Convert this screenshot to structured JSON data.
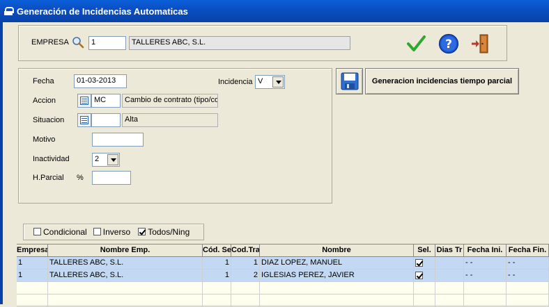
{
  "window": {
    "title": "Generación de Incidencias Automaticas"
  },
  "empresa": {
    "label": "EMPRESA",
    "code": "1",
    "name": "TALLERES ABC, S.L."
  },
  "form": {
    "fecha_label": "Fecha",
    "fecha_value": "01-03-2013",
    "incidencia_label": "Incidencia",
    "incidencia_value": "V",
    "accion_label": "Accion",
    "accion_code": "MC",
    "accion_desc": "Cambio de contrato (tipo/coe",
    "situacion_label": "Situacion",
    "situacion_code": "",
    "situacion_desc": "Alta",
    "motivo_label": "Motivo",
    "motivo_value": "",
    "inactividad_label": "Inactividad",
    "inactividad_value": "2",
    "hparcial_label": "H.Parcial",
    "hparcial_unit": "%",
    "hparcial_value": ""
  },
  "actions": {
    "generate_label": "Generacion incidencias tiempo parcial"
  },
  "filters": {
    "condicional_label": "Condicional",
    "condicional_checked": false,
    "inverso_label": "Inverso",
    "inverso_checked": false,
    "todos_label": "Todos/Ning",
    "todos_checked": true
  },
  "table": {
    "headers": [
      "Empresa",
      "Nombre Emp.",
      "Cód. Se",
      "Cod.Tra",
      "Nombre",
      "Sel.",
      "Dias Tr",
      "Fecha Ini.",
      "Fecha Fin."
    ],
    "rows": [
      {
        "empresa": "1",
        "nombre_emp": "TALLERES ABC, S.L.",
        "cod_se": "1",
        "cod_tra": "1",
        "nombre": "DIAZ  LOPEZ, MANUEL",
        "sel": true,
        "dias": "",
        "fecha_ini": "- -",
        "fecha_fin": "- -"
      },
      {
        "empresa": "1",
        "nombre_emp": "TALLERES ABC, S.L.",
        "cod_se": "1",
        "cod_tra": "2",
        "nombre": "IGLESIAS PEREZ, JAVIER",
        "sel": true,
        "dias": "",
        "fecha_ini": "- -",
        "fecha_fin": "- -"
      }
    ]
  },
  "colors": {
    "titlebar": "#0b4fc4",
    "selected_row": "#c3d9f3",
    "accept": "#2fa82f",
    "help": "#1a55c8",
    "exit": "#c0392b"
  }
}
